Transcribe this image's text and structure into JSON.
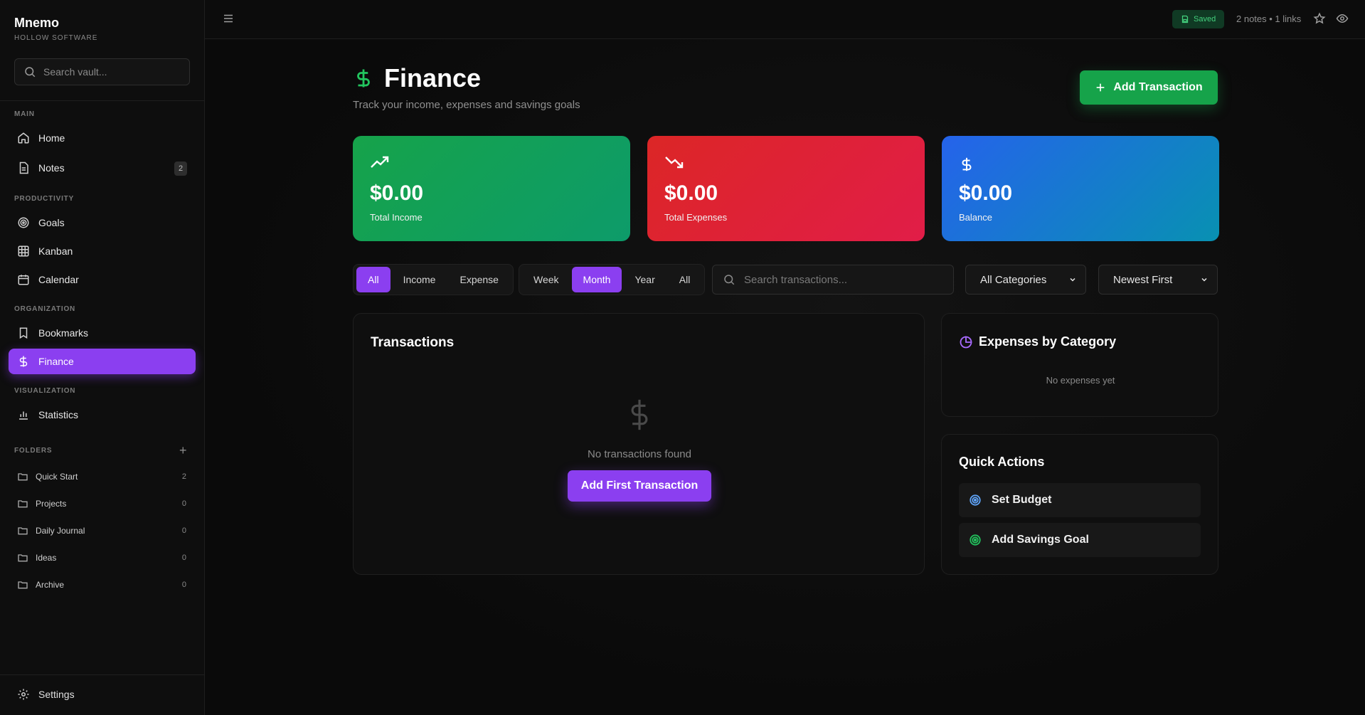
{
  "brand": {
    "name": "Mnemo",
    "subtitle": "HOLLOW SOFTWARE"
  },
  "sidebar": {
    "search_placeholder": "Search vault...",
    "sections": {
      "main": "MAIN",
      "productivity": "PRODUCTIVITY",
      "organization": "ORGANIZATION",
      "visualization": "VISUALIZATION",
      "folders": "FOLDERS"
    },
    "nav": {
      "home": "Home",
      "notes": "Notes",
      "notes_count": "2",
      "goals": "Goals",
      "kanban": "Kanban",
      "calendar": "Calendar",
      "bookmarks": "Bookmarks",
      "finance": "Finance",
      "statistics": "Statistics"
    },
    "folders": [
      {
        "name": "Quick Start",
        "count": "2"
      },
      {
        "name": "Projects",
        "count": "0"
      },
      {
        "name": "Daily Journal",
        "count": "0"
      },
      {
        "name": "Ideas",
        "count": "0"
      },
      {
        "name": "Archive",
        "count": "0"
      }
    ],
    "add_folder": "+",
    "settings": "Settings"
  },
  "topbar": {
    "saved": "Saved",
    "stats": "2 notes • 1 links"
  },
  "page": {
    "title": "Finance",
    "subtitle": "Track your income, expenses and savings goals",
    "add_button": "Add Transaction"
  },
  "cards": {
    "income": {
      "value": "$0.00",
      "label": "Total Income"
    },
    "expense": {
      "value": "$0.00",
      "label": "Total Expenses"
    },
    "balance": {
      "value": "$0.00",
      "label": "Balance"
    }
  },
  "filters": {
    "type": [
      "All",
      "Income",
      "Expense"
    ],
    "type_selected": "All",
    "period": [
      "Week",
      "Month",
      "Year",
      "All"
    ],
    "period_selected": "Month",
    "search_placeholder": "Search transactions...",
    "category": "All Categories",
    "sort": "Newest First"
  },
  "transactions": {
    "title": "Transactions",
    "empty": "No transactions found",
    "first_button": "Add First Transaction"
  },
  "expenses_by_category": {
    "title": "Expenses by Category",
    "empty": "No expenses yet"
  },
  "quick_actions": {
    "title": "Quick Actions",
    "set_budget": "Set Budget",
    "add_savings_goal": "Add Savings Goal"
  },
  "colors": {
    "accent": "#8b3ff0",
    "income": "#16a34a",
    "expense": "#dc2626",
    "balance": "#2563eb"
  }
}
